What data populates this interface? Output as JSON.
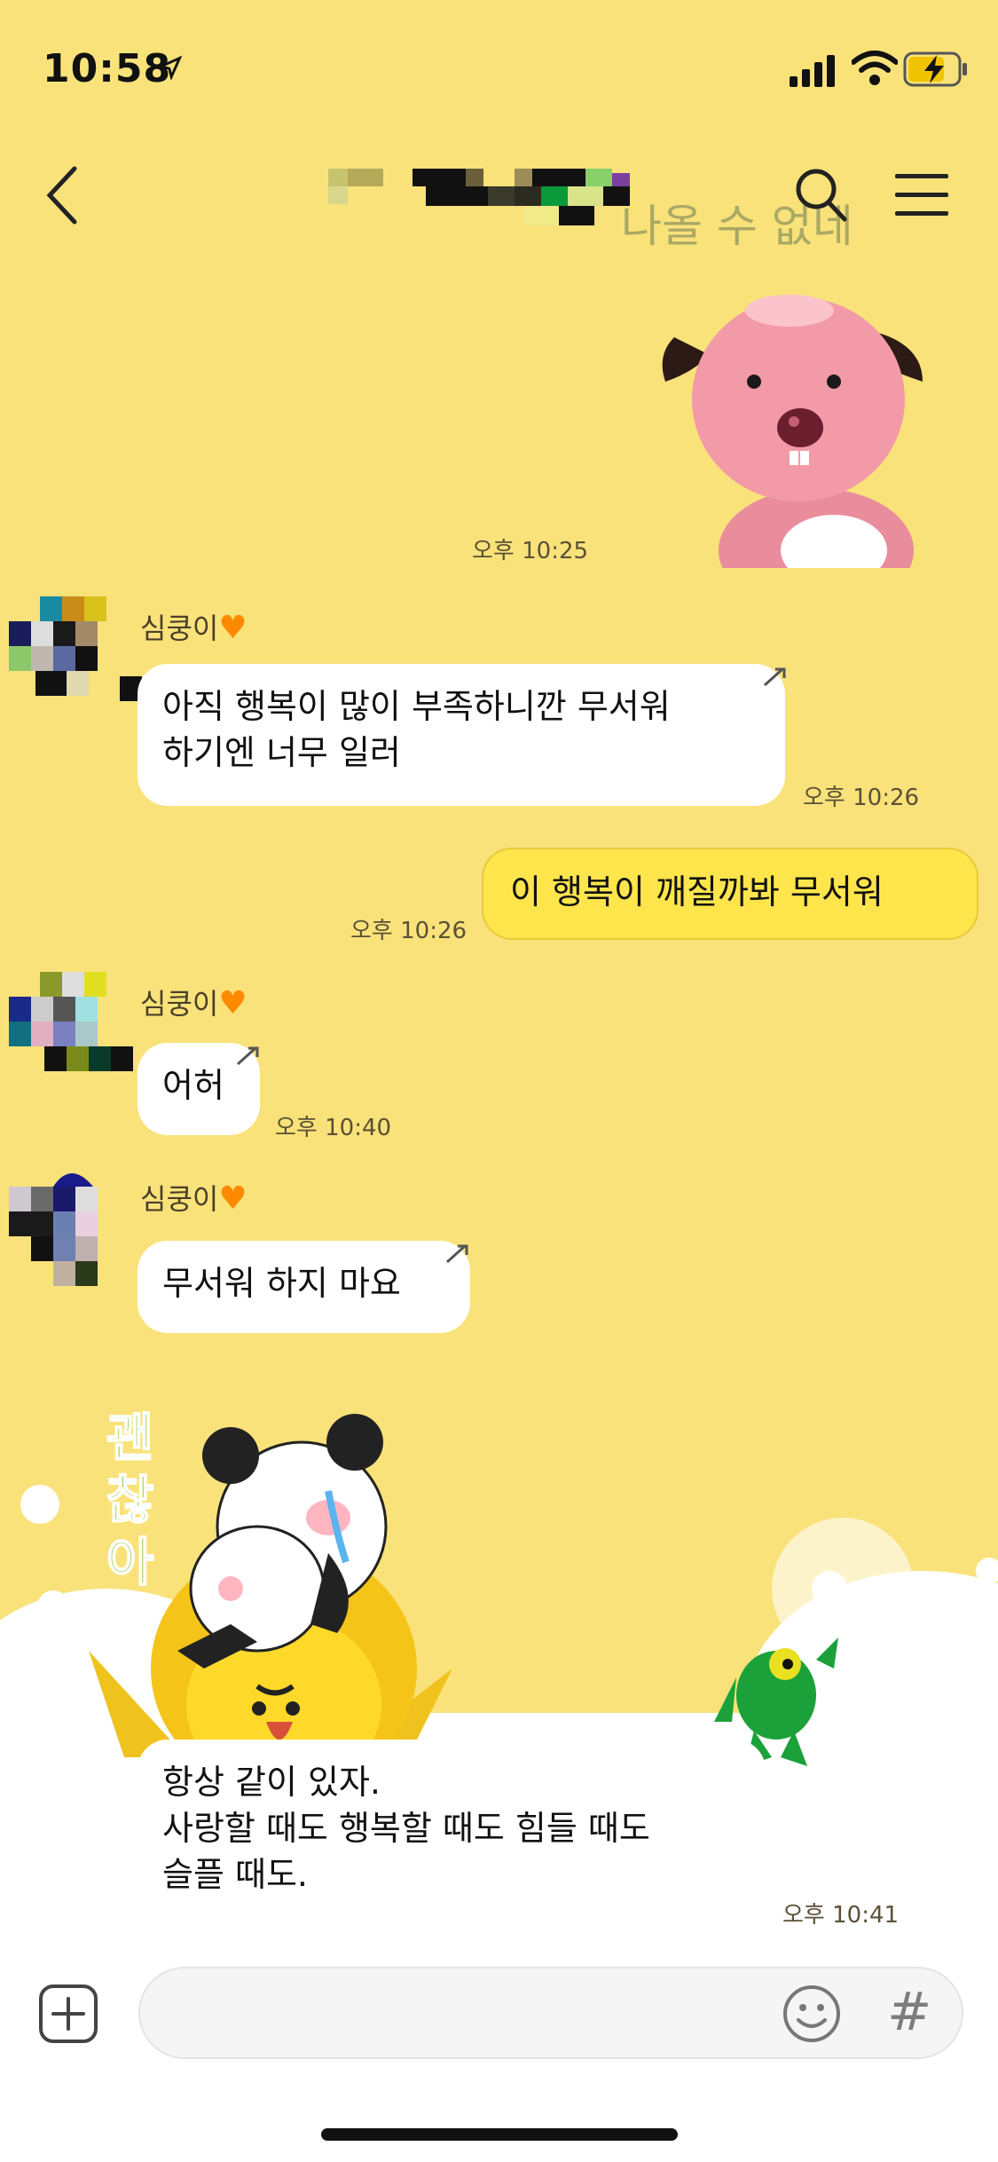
{
  "status_bar": {
    "time": "10:58"
  },
  "header": {
    "title_hidden": true,
    "overlay_text": "나올 수 없네"
  },
  "messages": [
    {
      "type": "sticker",
      "time": "오후 10:25"
    },
    {
      "sender": "심쿵이",
      "text_lines": [
        "아직 행복이 많이 부족하니깐 무서워",
        "하기엔 너무 일러"
      ],
      "time": "오후 10:26"
    },
    {
      "sender": "me",
      "text": "이 행복이 깨질까봐 무서워",
      "time": "오후 10:26"
    },
    {
      "sender": "심쿵이",
      "text": "어허",
      "time": "오후 10:40"
    },
    {
      "sender": "심쿵이",
      "text": "무서워 하지 마요"
    },
    {
      "type": "sticker",
      "sticker_text": [
        "괜",
        "찮",
        "아"
      ]
    },
    {
      "text_lines": [
        "항상 같이 있자.",
        "사랑할 때도 행복할 때도 힘들 때도",
        "슬플 때도."
      ],
      "time": "오후 10:41"
    }
  ],
  "input": {
    "hash_label": "#"
  },
  "colors": {
    "background": "#f9e27a",
    "bubble_out": "#fde54b",
    "heart": "#ff8a00"
  }
}
